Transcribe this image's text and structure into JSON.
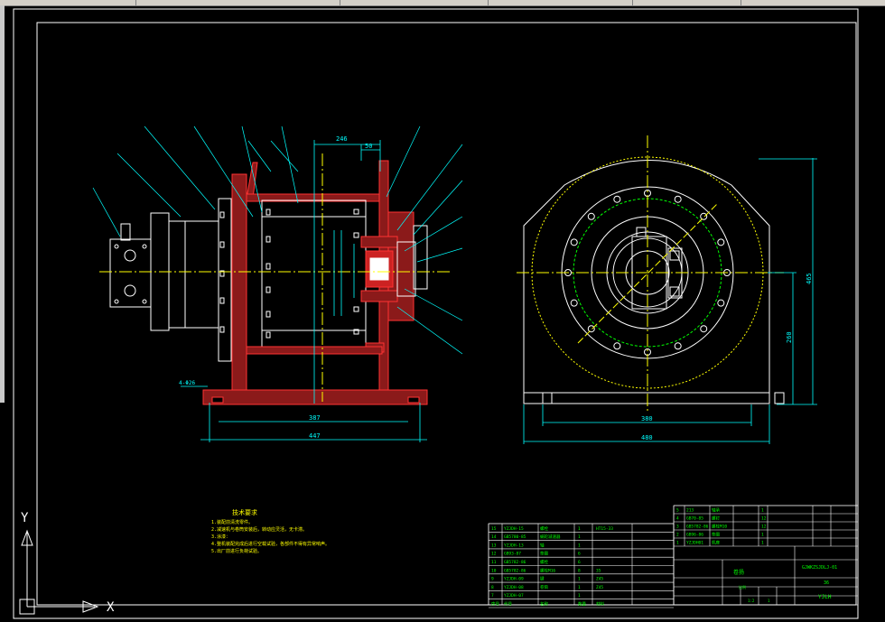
{
  "colors": {
    "background": "#000000",
    "frame": "#ffffff",
    "dimension": "#00ffff",
    "section_fill": "#8b1a1a",
    "section_edge": "#ff3333",
    "centerline": "#ffff00",
    "table_text": "#00ff00",
    "note_text": "#ffff00",
    "ucs": "#ffffff"
  },
  "ucs": {
    "y_label": "Y",
    "x_label": "X"
  },
  "front_view": {
    "dims": {
      "top_width": "246",
      "top_small": "50",
      "bottom_inner": "387",
      "bottom_overall": "447",
      "left_hole": "4-Φ26"
    }
  },
  "side_view": {
    "dims": {
      "base_inner": "380",
      "base_overall": "480",
      "height_center": "260",
      "height_overall": "465"
    }
  },
  "notes": {
    "title": "技术要求",
    "lines": [
      "1.装配前清洗零件。",
      "2.减速机与卷筒安装后，转动应灵活，无卡滞。",
      "3.涂漆：",
      "4.整机装配完成后进行空载试验，各部件不得有异常响声。",
      "5.出厂前进行负荷试验。"
    ]
  },
  "parts_list": {
    "rows": [
      {
        "no": "15",
        "code": "YZJDH-15",
        "name": "螺栓",
        "qty": "1",
        "mat": "HT15-33"
      },
      {
        "no": "14",
        "code": "GB5780-85",
        "name": "蜗轮减速器",
        "qty": "1",
        "mat": ""
      },
      {
        "no": "13",
        "code": "YZJDH-13",
        "name": "轴",
        "qty": "1",
        "mat": ""
      },
      {
        "no": "12",
        "code": "GB93-87",
        "name": "垫圈",
        "qty": "6",
        "mat": ""
      },
      {
        "no": "11",
        "code": "GB5782-86",
        "name": "螺栓",
        "qty": "6",
        "mat": ""
      },
      {
        "no": "10",
        "code": "GB5782-86",
        "name": "螺栓M16",
        "qty": "8",
        "mat": "35"
      },
      {
        "no": "9",
        "code": "YZJDH-09",
        "name": "键",
        "qty": "1",
        "mat": "Z45"
      },
      {
        "no": "8",
        "code": "YZJDH-08",
        "name": "卷筒",
        "qty": "1",
        "mat": "Z45"
      },
      {
        "no": "7",
        "code": "YZJDH-07",
        "name": "",
        "qty": "1",
        "mat": ""
      }
    ],
    "header": {
      "no": "序号",
      "code": "代号",
      "name": "名称",
      "qty": "数量",
      "mat": "材料"
    }
  },
  "upper_parts": {
    "rows": [
      {
        "no": "5",
        "code": "213",
        "name": "轴承",
        "qty": "1"
      },
      {
        "no": "4",
        "code": "GB70-85",
        "name": "螺钉",
        "qty": "12"
      },
      {
        "no": "3",
        "code": "GB5782-86",
        "name": "螺栓M10",
        "qty": "12"
      },
      {
        "no": "2",
        "code": "GB96-86",
        "name": "垫圈",
        "qty": "1"
      },
      {
        "no": "1",
        "code": "YZJDH01",
        "name": "机座",
        "qty": "1"
      }
    ]
  },
  "title_block": {
    "part_name": "卷扬",
    "drawing_no": "GJWKZSJDLJ-01",
    "material": "36",
    "scale_label": "比例",
    "scale": "1:2",
    "sheet": "1",
    "company": "YJLH"
  }
}
